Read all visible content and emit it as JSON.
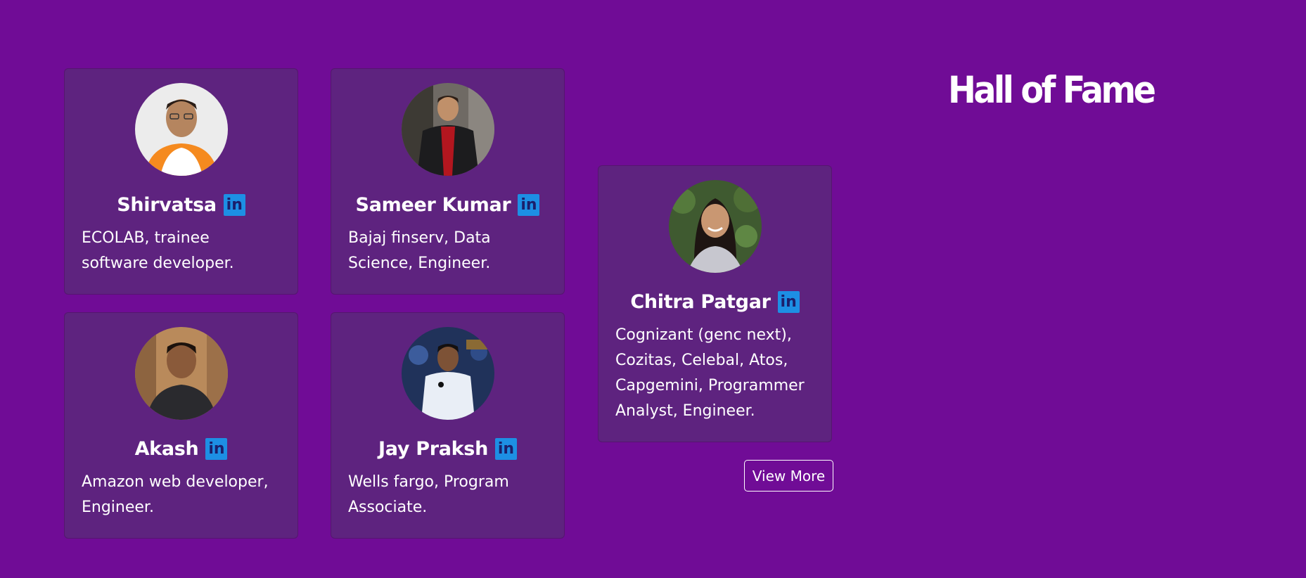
{
  "page": {
    "title": "Hall of Fame"
  },
  "members": [
    {
      "name": "Shirvatsa",
      "description": "ECOLAB, trainee software developer.",
      "linkedin_icon": "linkedin-icon"
    },
    {
      "name": "Sameer Kumar",
      "description": "Bajaj finserv, Data Science, Engineer.",
      "linkedin_icon": "linkedin-icon"
    },
    {
      "name": "Chitra Patgar",
      "description": "Cognizant (genc next), Cozitas, Celebal, Atos, Capgemini, Programmer Analyst, Engineer.",
      "linkedin_icon": "linkedin-icon"
    },
    {
      "name": "Akash",
      "description": "Amazon web developer, Engineer.",
      "linkedin_icon": "linkedin-icon"
    },
    {
      "name": "Jay Praksh",
      "description": "Wells fargo, Program Associate.",
      "linkedin_icon": "linkedin-icon"
    }
  ],
  "actions": {
    "view_more": "View More"
  },
  "colors": {
    "background": "#700c96",
    "card": "#5e237f",
    "linkedin": "#1d8fe4"
  }
}
